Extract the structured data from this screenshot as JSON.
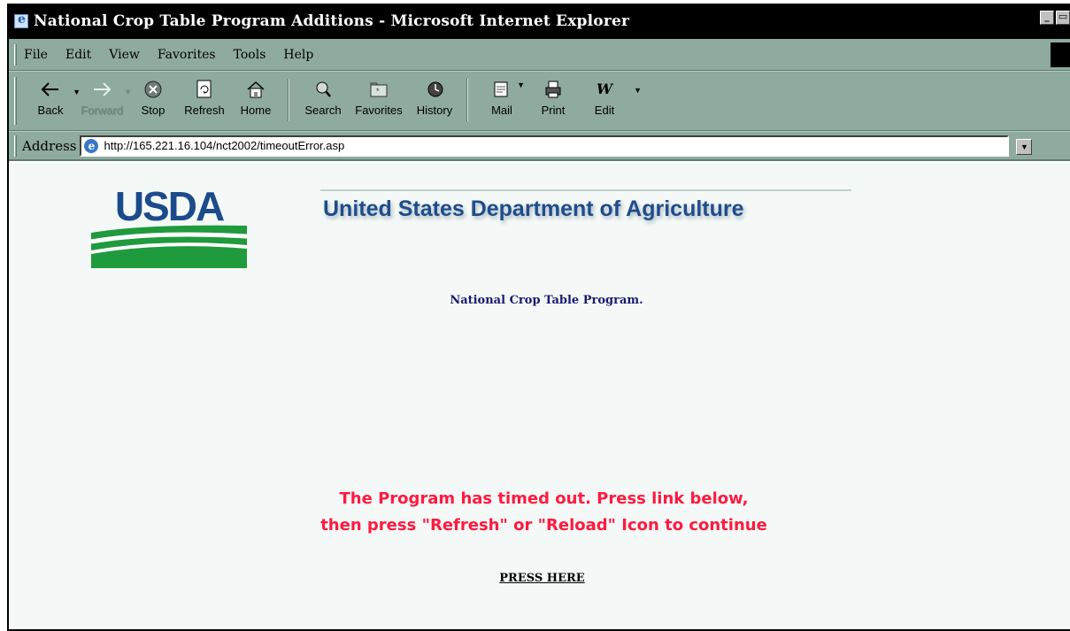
{
  "window": {
    "title": "National Crop Table Program Additions - Microsoft Internet Explorer",
    "minimize_glyph": "_",
    "maximize_glyph": "▭"
  },
  "menu": [
    {
      "label": "File",
      "accel": "F"
    },
    {
      "label": "Edit",
      "accel": "E"
    },
    {
      "label": "View",
      "accel": "V"
    },
    {
      "label": "Favorites",
      "accel": "a"
    },
    {
      "label": "Tools",
      "accel": "T"
    },
    {
      "label": "Help",
      "accel": "H"
    }
  ],
  "toolbar": {
    "back": "Back",
    "forward": "Forward",
    "stop": "Stop",
    "refresh": "Refresh",
    "home": "Home",
    "search": "Search",
    "favorites": "Favorites",
    "history": "History",
    "mail": "Mail",
    "print": "Print",
    "edit": "Edit",
    "edit_glyph": "W"
  },
  "address": {
    "label": "Address",
    "url": "http://165.221.16.104/nct2002/timeoutError.asp"
  },
  "page": {
    "logo_text": "USDA",
    "department": "United States Department of Agriculture",
    "program": "National Crop Table Program.",
    "timeout_line1": "The Program has timed out.  Press link below,",
    "timeout_line2": "then press \"Refresh\" or \"Reload\" Icon to continue",
    "press_here": "PRESS HERE"
  },
  "colors": {
    "chrome": "#8faa9e",
    "content_bg": "#f4f9f7",
    "usda_blue": "#1c4b8c",
    "usda_green": "#1f9a3c",
    "timeout_red": "#ff1a40"
  }
}
